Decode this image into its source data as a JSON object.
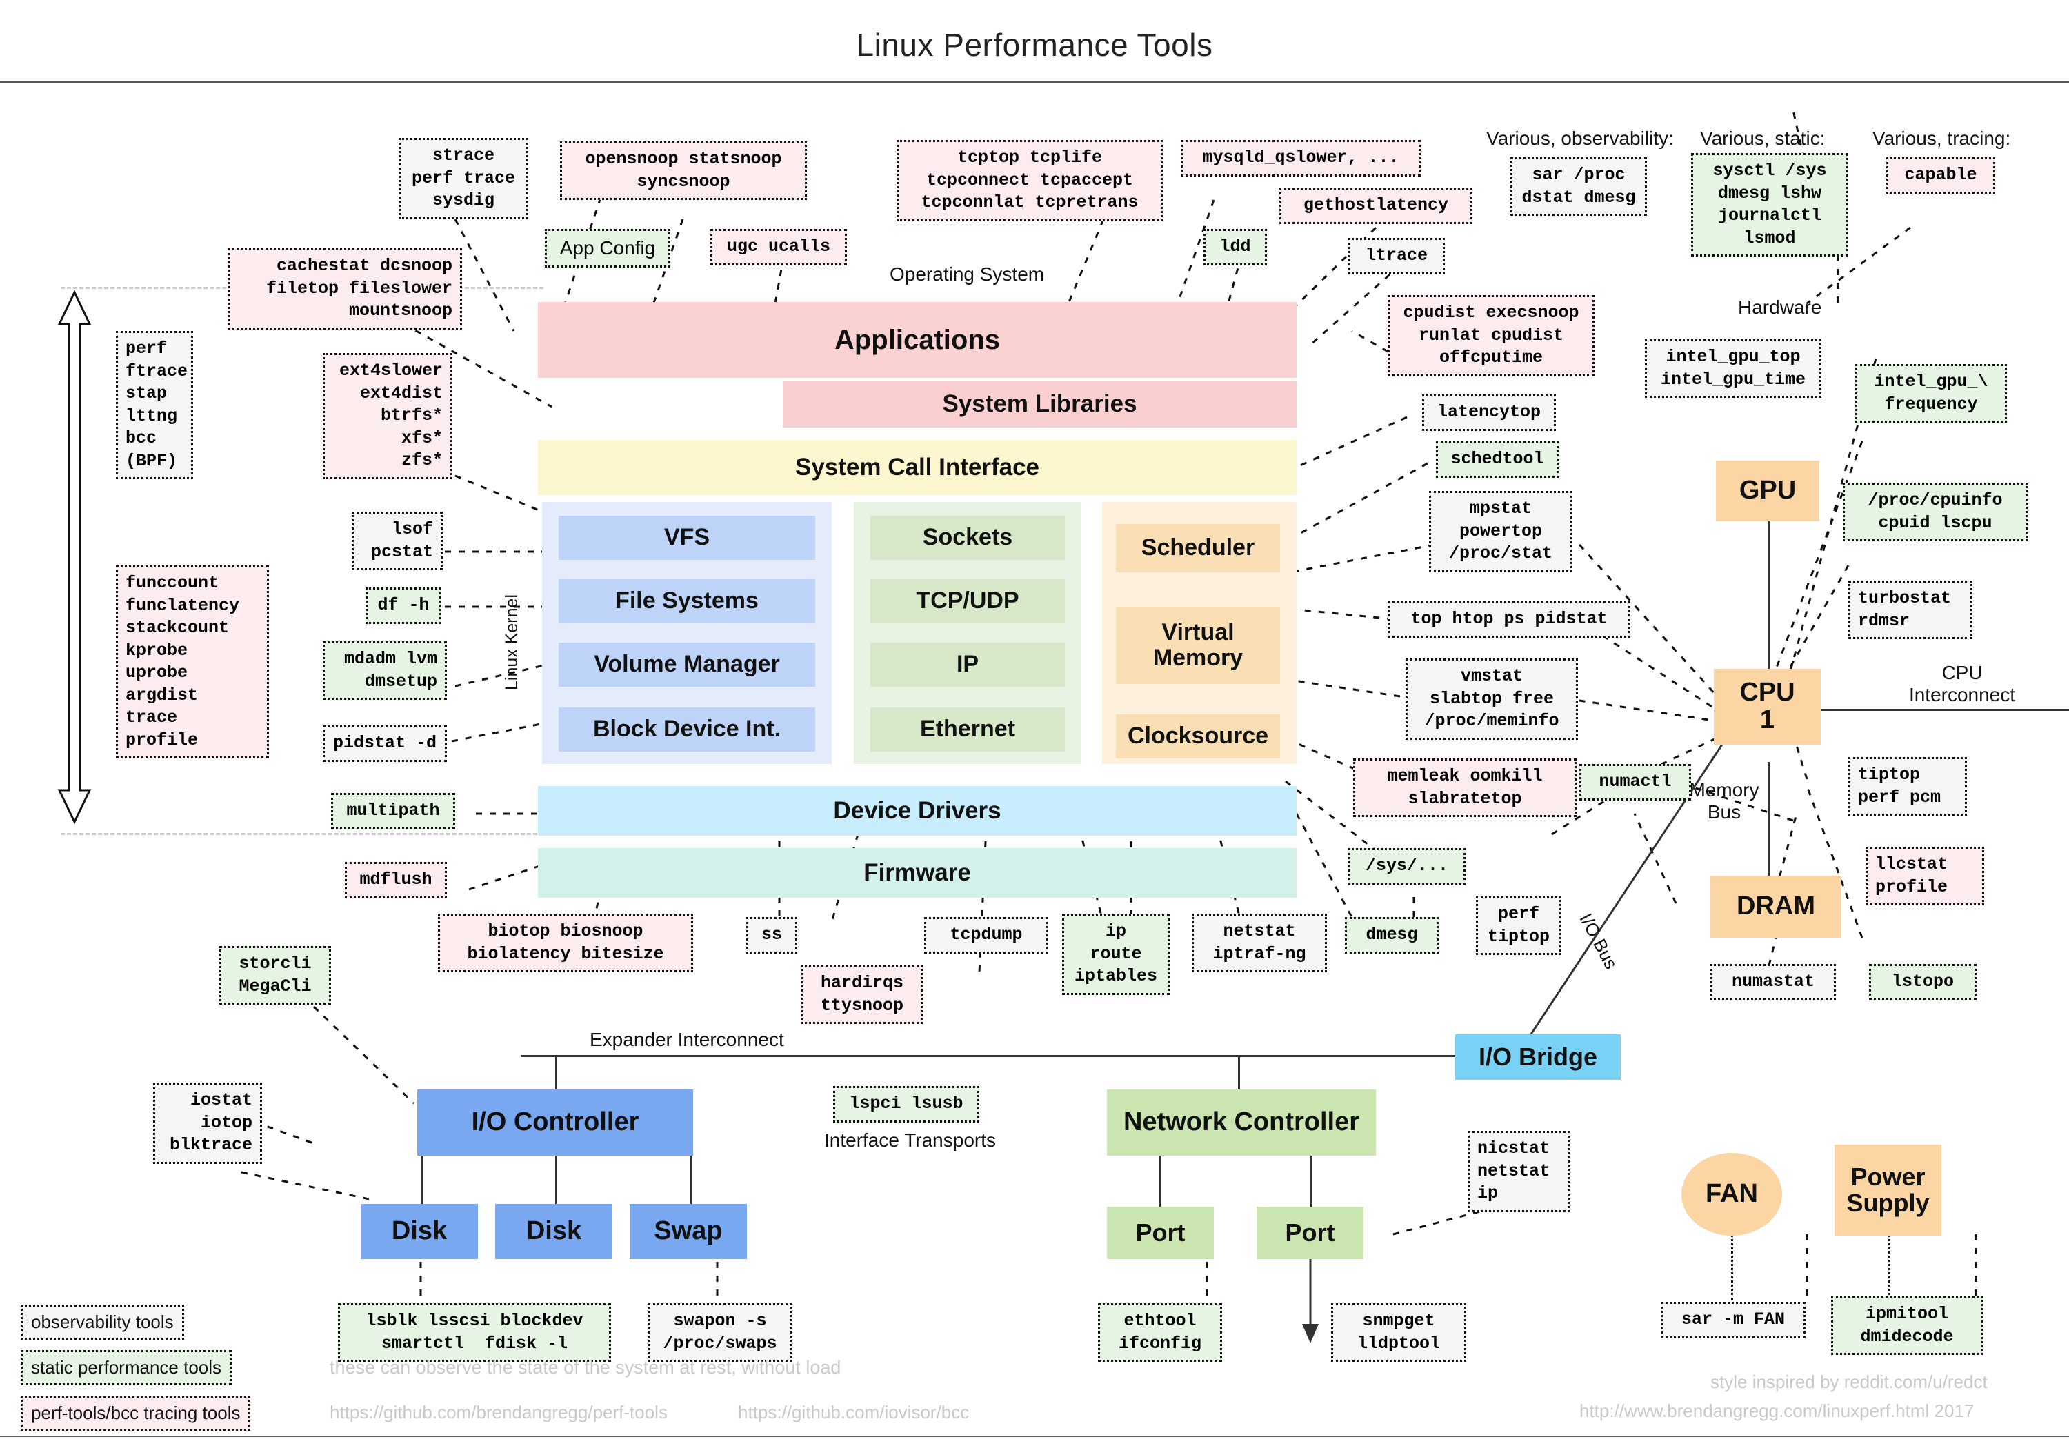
{
  "title": "Linux Performance Tools",
  "section_labels": {
    "operating_system": "Operating System",
    "hardware": "Hardware",
    "linux_kernel": "Linux Kernel",
    "various_observability": "Various, observability:",
    "various_static": "Various, static:",
    "various_tracing": "Various, tracing:",
    "cpu_interconnect": "CPU\nInterconnect",
    "memory_bus": "Memory\nBus",
    "io_bus": "I/O Bus",
    "expander_interconnect": "Expander Interconnect",
    "interface_transports": "Interface Transports"
  },
  "stack": {
    "applications": "Applications",
    "system_libraries": "System Libraries",
    "system_call_interface": "System Call Interface",
    "device_drivers": "Device Drivers",
    "firmware": "Firmware",
    "file_group": [
      "VFS",
      "File Systems",
      "Volume Manager",
      "Block Device Int."
    ],
    "net_group": [
      "Sockets",
      "TCP/UDP",
      "IP",
      "Ethernet"
    ],
    "cpu_group": [
      "Scheduler",
      "Virtual\nMemory",
      "Clocksource"
    ]
  },
  "hardware_blocks": {
    "gpu": "GPU",
    "cpu1": "CPU\n1",
    "dram": "DRAM",
    "io_bridge": "I/O Bridge",
    "io_controller": "I/O Controller",
    "disk1": "Disk",
    "disk2": "Disk",
    "swap": "Swap",
    "network_controller": "Network Controller",
    "port1": "Port",
    "port2": "Port",
    "fan": "FAN",
    "power_supply": "Power\nSupply"
  },
  "tools": {
    "strace": "strace\nperf trace\nsysdig",
    "opensnoop": "opensnoop statsnoop\nsyncsnoop",
    "tcptop": "tcptop tcplife\ntcpconnect tcpaccept\ntcpconnlat tcpretrans",
    "mysqld_qslower": "mysqld_qslower, ...",
    "gethostlatency": "gethostlatency",
    "app_config": "App Config",
    "ugc_ucalls": "ugc ucalls",
    "ldd": "ldd",
    "ltrace": "ltrace",
    "cachestat": "cachestat dcsnoop\nfiletop fileslower\nmountsnoop",
    "sar_proc": "sar /proc\ndstat dmesg",
    "sysctl": "sysctl /sys\ndmesg lshw\njournalctl\nlsmod",
    "capable": "capable",
    "cpudist": "cpudist execsnoop\nrunlat cpudist\noffcputime",
    "intel_gpu_top": "intel_gpu_top\nintel_gpu_time",
    "intel_gpu_freq": "intel_gpu_\\\nfrequency",
    "latencytop": "latencytop",
    "schedtool": "schedtool",
    "mpstat": "mpstat\npowertop\n/proc/stat",
    "proc_cpuinfo": "/proc/cpuinfo\ncpuid lscpu",
    "turbostat": "turbostat\nrdmsr",
    "perf_ftrace": "perf\nftrace\nstap\nlttng\nbcc\n(BPF)",
    "ext4slower": "ext4slower\next4dist\nbtrfs*\nxfs*\nzfs*",
    "lsof_pcstat": "lsof\npcstat",
    "df_h": "df -h",
    "mdadm_lvm": "mdadm lvm\ndmsetup",
    "pidstat_d": "pidstat -d",
    "multipath": "multipath",
    "mdflush": "mdflush",
    "funccount": "funccount\nfunclatency\nstackcount\nkprobe\nuprobe\nargdist\ntrace\nprofile",
    "top_htop": "top htop ps pidstat",
    "vmstat": "vmstat\nslabtop free\n/proc/meminfo",
    "memleak": "memleak oomkill\nslabratetop",
    "numactl": "numactl",
    "tiptop_perf_pcm": "tiptop\nperf pcm",
    "llcstat": "llcstat\nprofile",
    "sys_dots": "/sys/...",
    "dmesg_mid": "dmesg",
    "perf_tiptop": "perf\ntiptop",
    "numastat": "numastat",
    "lstopo": "lstopo",
    "biotop": "biotop biosnoop\nbiolatency bitesize",
    "ss": "ss",
    "hardirqs": "hardirqs\nttysnoop",
    "tcpdump": "tcpdump",
    "ip_route": "ip\nroute\niptables",
    "netstat_iptraf": "netstat\niptraf-ng",
    "storcli": "storcli\nMegaCli",
    "iostat": "iostat\niotop\nblktrace",
    "lspci_lsusb": "lspci lsusb",
    "lsblk": "lsblk lsscsi blockdev\nsmartctl  fdisk -l",
    "swapon": "swapon -s\n/proc/swaps",
    "nicstat": "nicstat\nnetstat\nip",
    "ethtool": "ethtool\nifconfig",
    "snmpget": "snmpget\nlldptool",
    "sar_m_fan": "sar -m FAN",
    "ipmitool": "ipmitool\ndmidecode"
  },
  "legend": {
    "observability": "observability tools",
    "static": "static performance tools",
    "tracing": "perf-tools/bcc tracing tools",
    "note_static": "these can observe the state of the system at rest, without load",
    "url_perf_tools": "https://github.com/brendangregg/perf-tools",
    "url_bcc": "https://github.com/iovisor/bcc",
    "credit_style": "style inspired by reddit.com/u/redct",
    "credit_url": "http://www.brendangregg.com/linuxperf.html 2017"
  },
  "colors": {
    "observability_bg": "#f5f5f5",
    "static_bg": "#e6f5e3",
    "tracing_bg": "#fdeced",
    "applications": "#fad2d2",
    "syscall": "#fcf6cf",
    "kernel_blue": "#bdd3f7",
    "kernel_green": "#d6e8c8",
    "kernel_orange": "#fbdfb4",
    "device_drivers": "#c7ecfb",
    "firmware": "#d3f0ea",
    "hardware_orange": "#fbd5a4",
    "io_bridge": "#79d2f5",
    "io_controller": "#7aa8f0",
    "network": "#cbe5b0"
  }
}
